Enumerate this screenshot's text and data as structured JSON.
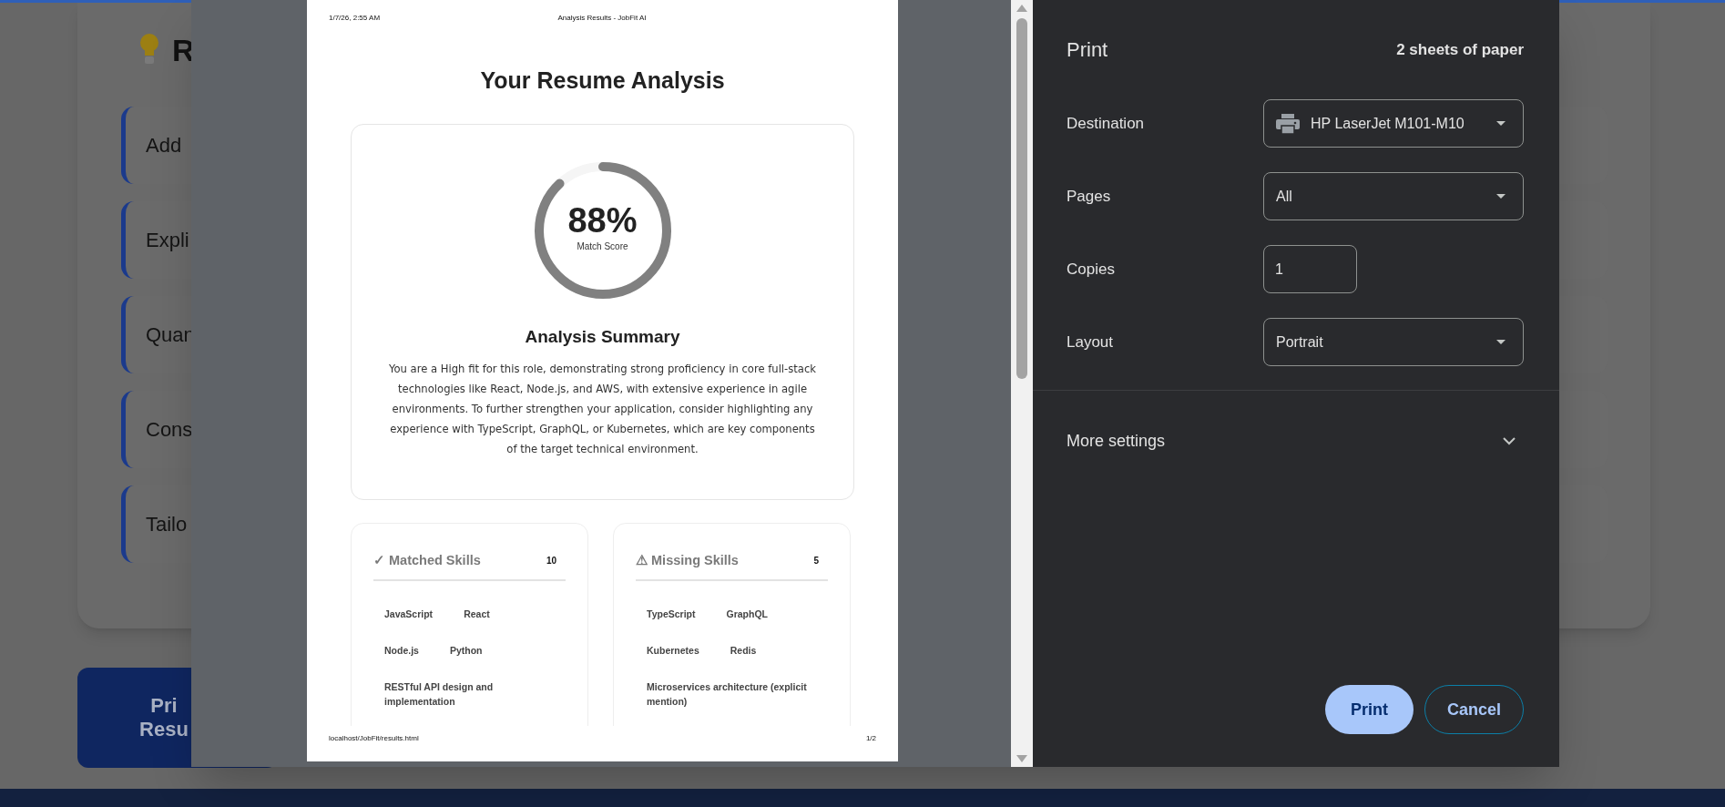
{
  "background_page": {
    "section_title": "R",
    "recommendations": [
      "Add",
      "Expli",
      "Quan",
      "Cons",
      "Tailo"
    ],
    "print_button_lines": [
      "Pri",
      "Resu"
    ]
  },
  "print_preview": {
    "header_date": "1/7/26, 2:55 AM",
    "header_title": "Analysis Results - JobFit AI",
    "title": "Your Resume Analysis",
    "score": {
      "value": "88%",
      "label": "Match Score",
      "level": 0.88
    },
    "summary_title": "Analysis Summary",
    "summary": "You are a High fit for this role, demonstrating strong proficiency in core full-stack technologies like React, Node.js, and AWS, with extensive experience in agile environments. To further strengthen your application, consider highlighting any experience with TypeScript, GraphQL, or Kubernetes, which are key components of the target technical environment.",
    "skill_groups": [
      {
        "icon": "✓",
        "title": "Matched Skills",
        "count": "10",
        "skills": [
          "JavaScript",
          "React",
          "Node.js",
          "Python",
          "RESTful API design and implementation"
        ]
      },
      {
        "icon": "⚠",
        "title": "Missing Skills",
        "count": "5",
        "skills": [
          "TypeScript",
          "GraphQL",
          "Kubernetes",
          "Redis",
          "Microservices architecture (explicit mention)"
        ]
      }
    ],
    "footer_url": "localhost/JobFit/results.html",
    "footer_page": "1/2"
  },
  "print_settings": {
    "title": "Print",
    "sheets": "2 sheets of paper",
    "fields": [
      {
        "kind": "printer_dropdown",
        "label": "Destination",
        "value": "HP LaserJet M101-M10"
      },
      {
        "kind": "dropdown",
        "label": "Pages",
        "value": "All"
      },
      {
        "kind": "number",
        "label": "Copies",
        "value": "1"
      },
      {
        "kind": "dropdown",
        "label": "Layout",
        "value": "Portrait"
      }
    ],
    "more_settings": {
      "label": "More settings",
      "expanded": false
    },
    "buttons": [
      {
        "kind": "primary",
        "label": "Print"
      },
      {
        "kind": "secondary",
        "label": "Cancel"
      }
    ]
  }
}
